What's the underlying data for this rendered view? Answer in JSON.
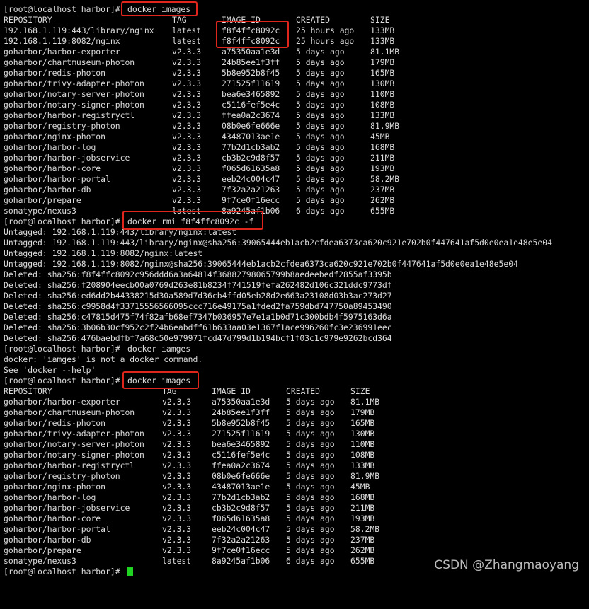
{
  "terminal": {
    "prompt": "[root@localhost harbor]#",
    "cmd_images_1": "docker images",
    "cmd_rmi": "docker rmi f8f4ffc8092c -f",
    "cmd_typo": "docker iamges",
    "cmd_images_2": "docker images",
    "err_typo": "docker: 'iamges' is not a docker command.",
    "err_help": "See 'docker --help'",
    "headers": [
      "REPOSITORY",
      "TAG",
      "IMAGE ID",
      "CREATED",
      "SIZE"
    ],
    "images_1": [
      [
        "192.168.1.119:443/library/nginx",
        "latest",
        "f8f4ffc8092c",
        "25 hours ago",
        "133MB"
      ],
      [
        "192.168.1.119:8082/nginx",
        "latest",
        "f8f4ffc8092c",
        "25 hours ago",
        "133MB"
      ],
      [
        "goharbor/harbor-exporter",
        "v2.3.3",
        "a75350aa1e3d",
        "5 days ago",
        "81.1MB"
      ],
      [
        "goharbor/chartmuseum-photon",
        "v2.3.3",
        "24b85ee1f3ff",
        "5 days ago",
        "179MB"
      ],
      [
        "goharbor/redis-photon",
        "v2.3.3",
        "5b8e952b8f45",
        "5 days ago",
        "165MB"
      ],
      [
        "goharbor/trivy-adapter-photon",
        "v2.3.3",
        "271525f11619",
        "5 days ago",
        "130MB"
      ],
      [
        "goharbor/notary-server-photon",
        "v2.3.3",
        "bea6e3465892",
        "5 days ago",
        "110MB"
      ],
      [
        "goharbor/notary-signer-photon",
        "v2.3.3",
        "c5116fef5e4c",
        "5 days ago",
        "108MB"
      ],
      [
        "goharbor/harbor-registryctl",
        "v2.3.3",
        "ffea0a2c3674",
        "5 days ago",
        "133MB"
      ],
      [
        "goharbor/registry-photon",
        "v2.3.3",
        "08b0e6fe666e",
        "5 days ago",
        "81.9MB"
      ],
      [
        "goharbor/nginx-photon",
        "v2.3.3",
        "43487013ae1e",
        "5 days ago",
        "45MB"
      ],
      [
        "goharbor/harbor-log",
        "v2.3.3",
        "77b2d1cb3ab2",
        "5 days ago",
        "168MB"
      ],
      [
        "goharbor/harbor-jobservice",
        "v2.3.3",
        "cb3b2c9d8f57",
        "5 days ago",
        "211MB"
      ],
      [
        "goharbor/harbor-core",
        "v2.3.3",
        "f065d61635a8",
        "5 days ago",
        "193MB"
      ],
      [
        "goharbor/harbor-portal",
        "v2.3.3",
        "eeb24c004c47",
        "5 days ago",
        "58.2MB"
      ],
      [
        "goharbor/harbor-db",
        "v2.3.3",
        "7f32a2a21263",
        "5 days ago",
        "237MB"
      ],
      [
        "goharbor/prepare",
        "v2.3.3",
        "9f7ce0f16ecc",
        "5 days ago",
        "262MB"
      ],
      [
        "sonatype/nexus3",
        "latest",
        "8a9245af1b06",
        "6 days ago",
        "655MB"
      ]
    ],
    "rmi_output": [
      "Untagged: 192.168.1.119:443/library/nginx:latest",
      "Untagged: 192.168.1.119:443/library/nginx@sha256:39065444eb1acb2cfdea6373ca620c921e702b0f447641af5d0e0ea1e48e5e04",
      "Untagged: 192.168.1.119:8082/nginx:latest",
      "Untagged: 192.168.1.119:8082/nginx@sha256:39065444eb1acb2cfdea6373ca620c921e702b0f447641af5d0e0ea1e48e5e04",
      "Deleted: sha256:f8f4ffc8092c956ddd6a3a64814f36882798065799b8aedeebedf2855af3395b",
      "Deleted: sha256:f208904eecb00a0769d263e81b8234f741519fefa262482d106c321ddc9773df",
      "Deleted: sha256:ed6dd2b44338215d30a589d7d36cb4ffd05eb28d2e663a23108d03b3ac273d27",
      "Deleted: sha256:c9958d4f33715556566095ccc716e49175a1fded2fa759dbd747750a89453490",
      "Deleted: sha256:c47815d475f74f82afb68ef7347b036957e7e1a1b0d71c300bdb4f5975163d6a",
      "Deleted: sha256:3b06b30cf952c2f24b6eabdff61b633aa03e1367f1ace996260fc3e236991eec",
      "Deleted: sha256:476baebdfbf7a68c50e979971fcd47d799d1b194bcf1f03c1c979e9262bcd364"
    ],
    "images_2": [
      [
        "goharbor/harbor-exporter",
        "v2.3.3",
        "a75350aa1e3d",
        "5 days ago",
        "81.1MB"
      ],
      [
        "goharbor/chartmuseum-photon",
        "v2.3.3",
        "24b85ee1f3ff",
        "5 days ago",
        "179MB"
      ],
      [
        "goharbor/redis-photon",
        "v2.3.3",
        "5b8e952b8f45",
        "5 days ago",
        "165MB"
      ],
      [
        "goharbor/trivy-adapter-photon",
        "v2.3.3",
        "271525f11619",
        "5 days ago",
        "130MB"
      ],
      [
        "goharbor/notary-server-photon",
        "v2.3.3",
        "bea6e3465892",
        "5 days ago",
        "110MB"
      ],
      [
        "goharbor/notary-signer-photon",
        "v2.3.3",
        "c5116fef5e4c",
        "5 days ago",
        "108MB"
      ],
      [
        "goharbor/harbor-registryctl",
        "v2.3.3",
        "ffea0a2c3674",
        "5 days ago",
        "133MB"
      ],
      [
        "goharbor/registry-photon",
        "v2.3.3",
        "08b0e6fe666e",
        "5 days ago",
        "81.9MB"
      ],
      [
        "goharbor/nginx-photon",
        "v2.3.3",
        "43487013ae1e",
        "5 days ago",
        "45MB"
      ],
      [
        "goharbor/harbor-log",
        "v2.3.3",
        "77b2d1cb3ab2",
        "5 days ago",
        "168MB"
      ],
      [
        "goharbor/harbor-jobservice",
        "v2.3.3",
        "cb3b2c9d8f57",
        "5 days ago",
        "211MB"
      ],
      [
        "goharbor/harbor-core",
        "v2.3.3",
        "f065d61635a8",
        "5 days ago",
        "193MB"
      ],
      [
        "goharbor/harbor-portal",
        "v2.3.3",
        "eeb24c004c47",
        "5 days ago",
        "58.2MB"
      ],
      [
        "goharbor/harbor-db",
        "v2.3.3",
        "7f32a2a21263",
        "5 days ago",
        "237MB"
      ],
      [
        "goharbor/prepare",
        "v2.3.3",
        "9f7ce0f16ecc",
        "5 days ago",
        "262MB"
      ],
      [
        "sonatype/nexus3",
        "latest",
        "8a9245af1b06",
        "6 days ago",
        "655MB"
      ]
    ]
  },
  "watermark": "CSDN @Zhangmaoyang",
  "colors": {
    "background": "#000000",
    "text": "#dcdcdc",
    "highlight": "#e0261c",
    "cursor": "#21d321"
  },
  "icons": {
    "cursor": "block-cursor"
  }
}
